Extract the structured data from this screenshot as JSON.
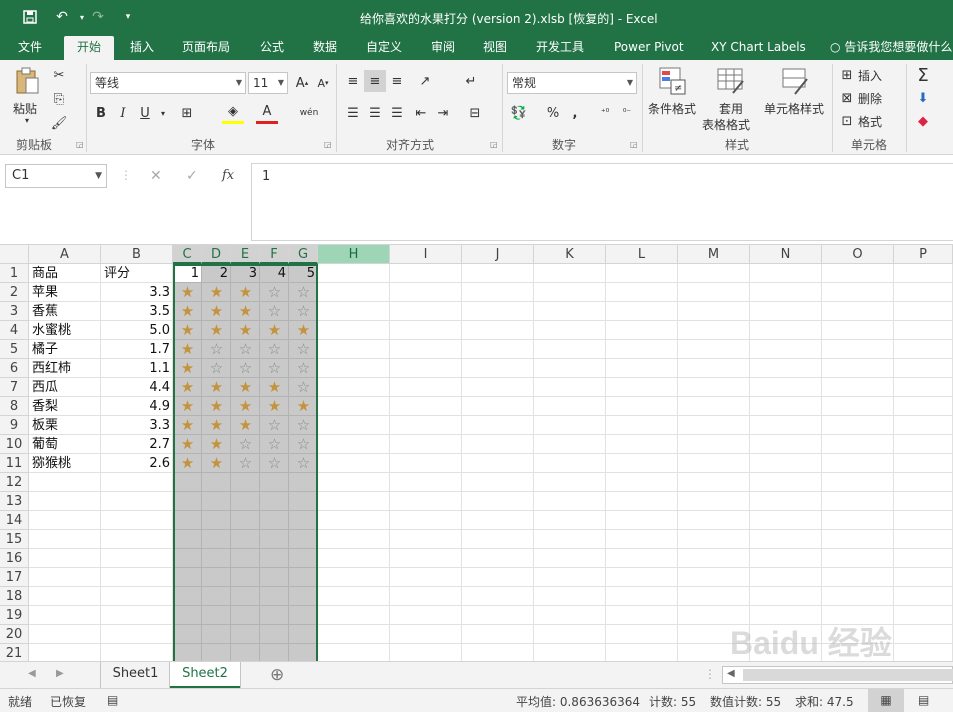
{
  "window": {
    "title": "给你喜欢的水果打分 (version 2).xlsb [恢复的] - Excel",
    "accent": "#217346"
  },
  "quick_access": {
    "save_icon": "save-icon",
    "undo_icon": "undo-icon",
    "redo_icon": "redo-icon",
    "customize_icon": "customize-icon"
  },
  "tabs": [
    "文件",
    "开始",
    "插入",
    "页面布局",
    "公式",
    "数据",
    "自定义",
    "审阅",
    "视图",
    "开发工具",
    "Power Pivot",
    "XY Chart Labels",
    "告诉我您想要做什么"
  ],
  "ribbon": {
    "clipboard": {
      "label": "剪贴板",
      "paste": "粘贴"
    },
    "font": {
      "label": "字体",
      "name": "等线",
      "size": "11",
      "bold": "B",
      "italic": "I",
      "underline": "U",
      "wen": "wén"
    },
    "alignment": {
      "label": "对齐方式"
    },
    "number": {
      "label": "数字",
      "format": "常规",
      "percent": "%",
      "comma": ","
    },
    "styles": {
      "label": "样式",
      "conditional": "条件格式",
      "table1": "套用",
      "table2": "表格格式",
      "cell": "单元格样式"
    },
    "cells": {
      "label": "单元格",
      "insert": "插入",
      "delete": "删除",
      "format": "格式"
    },
    "editing": {
      "sum": "Σ"
    }
  },
  "formula_bar": {
    "name_box": "C1",
    "cancel": "✕",
    "enter": "✓",
    "fx": "fx",
    "value": "1"
  },
  "columns": [
    "A",
    "B",
    "C",
    "D",
    "E",
    "F",
    "G",
    "H",
    "I",
    "J",
    "K",
    "L",
    "M",
    "N",
    "O",
    "P"
  ],
  "rows": [
    "1",
    "2",
    "3",
    "4",
    "5",
    "6",
    "7",
    "8",
    "9",
    "10",
    "11",
    "12",
    "13",
    "14",
    "15",
    "16",
    "17",
    "18",
    "19",
    "20",
    "21"
  ],
  "sheet": {
    "header": {
      "a": "商品",
      "b": "评分",
      "c": "1",
      "d": "2",
      "e": "3",
      "f": "4",
      "g": "5"
    },
    "data": [
      {
        "name": "苹果",
        "score": "3.3",
        "stars": [
          1,
          1,
          1,
          0,
          0
        ]
      },
      {
        "name": "香蕉",
        "score": "3.5",
        "stars": [
          1,
          1,
          1,
          0,
          0
        ]
      },
      {
        "name": "水蜜桃",
        "score": "5.0",
        "stars": [
          1,
          1,
          1,
          1,
          1
        ]
      },
      {
        "name": "橘子",
        "score": "1.7",
        "stars": [
          1,
          0,
          0,
          0,
          0
        ]
      },
      {
        "name": "西红柿",
        "score": "1.1",
        "stars": [
          1,
          0,
          0,
          0,
          0
        ]
      },
      {
        "name": "西瓜",
        "score": "4.4",
        "stars": [
          1,
          1,
          1,
          1,
          0
        ]
      },
      {
        "name": "香梨",
        "score": "4.9",
        "stars": [
          1,
          1,
          1,
          1,
          1
        ]
      },
      {
        "name": "板栗",
        "score": "3.3",
        "stars": [
          1,
          1,
          1,
          0,
          0
        ]
      },
      {
        "name": "葡萄",
        "score": "2.7",
        "stars": [
          1,
          1,
          0,
          0,
          0
        ]
      },
      {
        "name": "猕猴桃",
        "score": "2.6",
        "stars": [
          1,
          1,
          0,
          0,
          0
        ]
      }
    ],
    "star_full": "★",
    "star_empty": "☆"
  },
  "sheet_tabs": [
    "Sheet1",
    "Sheet2"
  ],
  "active_sheet": "Sheet2",
  "add_sheet": "⊕",
  "status": {
    "ready": "就绪",
    "recovered": "已恢复",
    "average": "平均值: 0.863636364",
    "count": "计数: 55",
    "numcount": "数值计数: 55",
    "sum": "求和: 47.5"
  },
  "watermark": "Baidu 经验"
}
